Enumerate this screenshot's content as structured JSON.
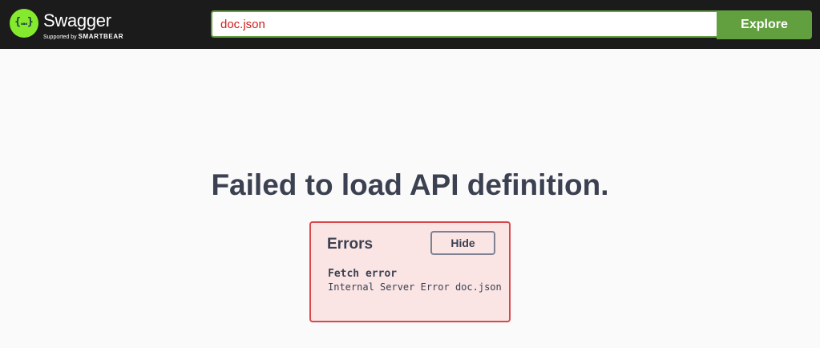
{
  "topbar": {
    "logo": {
      "icon": "swagger-braces-icon",
      "glyph": "{…}",
      "title": "Swagger",
      "supported_by": "Supported by",
      "brand": "SMARTBEAR"
    },
    "url_input": {
      "value": "doc.json"
    },
    "explore_label": "Explore"
  },
  "main": {
    "heading": "Failed to load API definition."
  },
  "errors": {
    "title": "Errors",
    "hide_label": "Hide",
    "items": [
      {
        "type": "Fetch error",
        "message": "Internal Server Error doc.json"
      }
    ]
  },
  "colors": {
    "topbar_bg": "#1b1b1b",
    "accent_green": "#62a03f",
    "logo_green": "#85ea2d",
    "error_border": "#d9474b",
    "error_bg": "#fae4e4",
    "text_dark": "#3b4151"
  }
}
